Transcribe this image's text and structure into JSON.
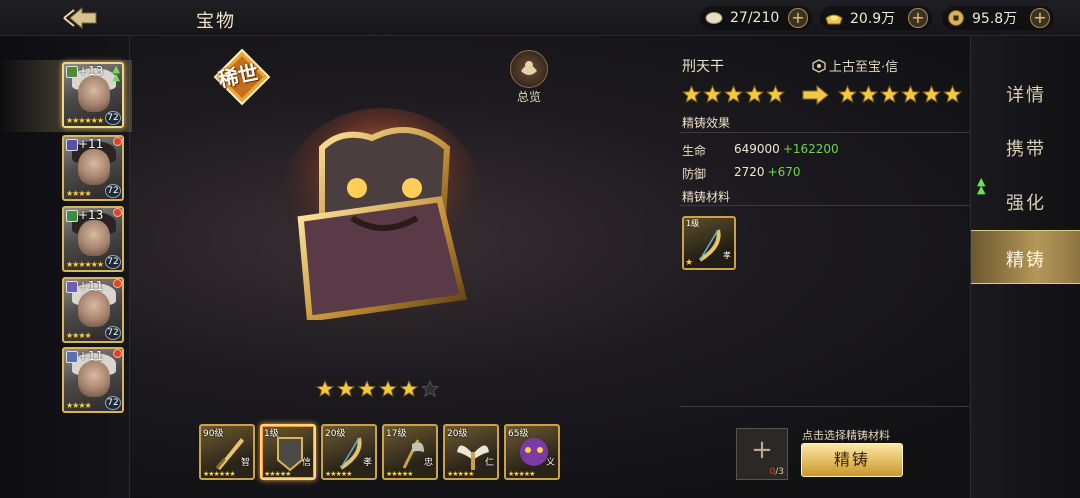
{
  "header": {
    "title": "宝物",
    "resources": [
      {
        "icon": "stamina-icon",
        "value": "27/210"
      },
      {
        "icon": "gold-ingot-icon",
        "value": "20.9万"
      },
      {
        "icon": "coin-icon",
        "value": "95.8万"
      }
    ],
    "plus_label": "+"
  },
  "heroes": [
    {
      "plus": "+13",
      "level": "72",
      "stars": "★★★★★★",
      "selected": true,
      "has_up": true
    },
    {
      "plus": "+11",
      "level": "72",
      "stars": "★★★★",
      "selected": false,
      "has_up": false
    },
    {
      "plus": "+13",
      "level": "72",
      "stars": "★★★★★★",
      "selected": false,
      "has_up": false
    },
    {
      "plus": "+11",
      "level": "72",
      "stars": "★★★★",
      "selected": false,
      "has_up": false
    },
    {
      "plus": "+11",
      "level": "72",
      "stars": "★★★★",
      "selected": false,
      "has_up": false
    }
  ],
  "center": {
    "rare_badge": "稀世",
    "overview_label": "总览",
    "stars_lit": 5,
    "stars_total": 6
  },
  "items": [
    {
      "level": "90级",
      "char": "智",
      "stars": "★★★★★★"
    },
    {
      "level": "1级",
      "char": "信",
      "stars": "★★★★★",
      "selected": true
    },
    {
      "level": "20级",
      "char": "孝",
      "stars": "★★★★★"
    },
    {
      "level": "17级",
      "char": "忠",
      "stars": "★★★★★"
    },
    {
      "level": "20级",
      "char": "仁",
      "stars": "★★★★★"
    },
    {
      "level": "65级",
      "char": "义",
      "stars": "★★★★★"
    }
  ],
  "detail": {
    "name": "刑天干",
    "quality": "上古至宝·信",
    "stars_current": 5,
    "stars_next": 6,
    "effect_title": "精铸效果",
    "stats": [
      {
        "key": "生命",
        "value": "649000",
        "delta": "+162200"
      },
      {
        "key": "防御",
        "value": "2720",
        "delta": "+670"
      }
    ],
    "material_title": "精铸材料",
    "material": {
      "level": "1级",
      "char": "孝"
    },
    "slot_count_used": "0",
    "slot_count_total": "/3",
    "hint": "点击选择精铸材料",
    "forge_label": "精铸"
  },
  "tabs": [
    {
      "label": "详情",
      "active": false
    },
    {
      "label": "携带",
      "active": false
    },
    {
      "label": "强化",
      "active": false
    },
    {
      "label": "精铸",
      "active": true
    }
  ],
  "colors": {
    "gold": "#e5bf63",
    "stat_increase": "#6cd64c",
    "reddot": "#e0432c"
  }
}
